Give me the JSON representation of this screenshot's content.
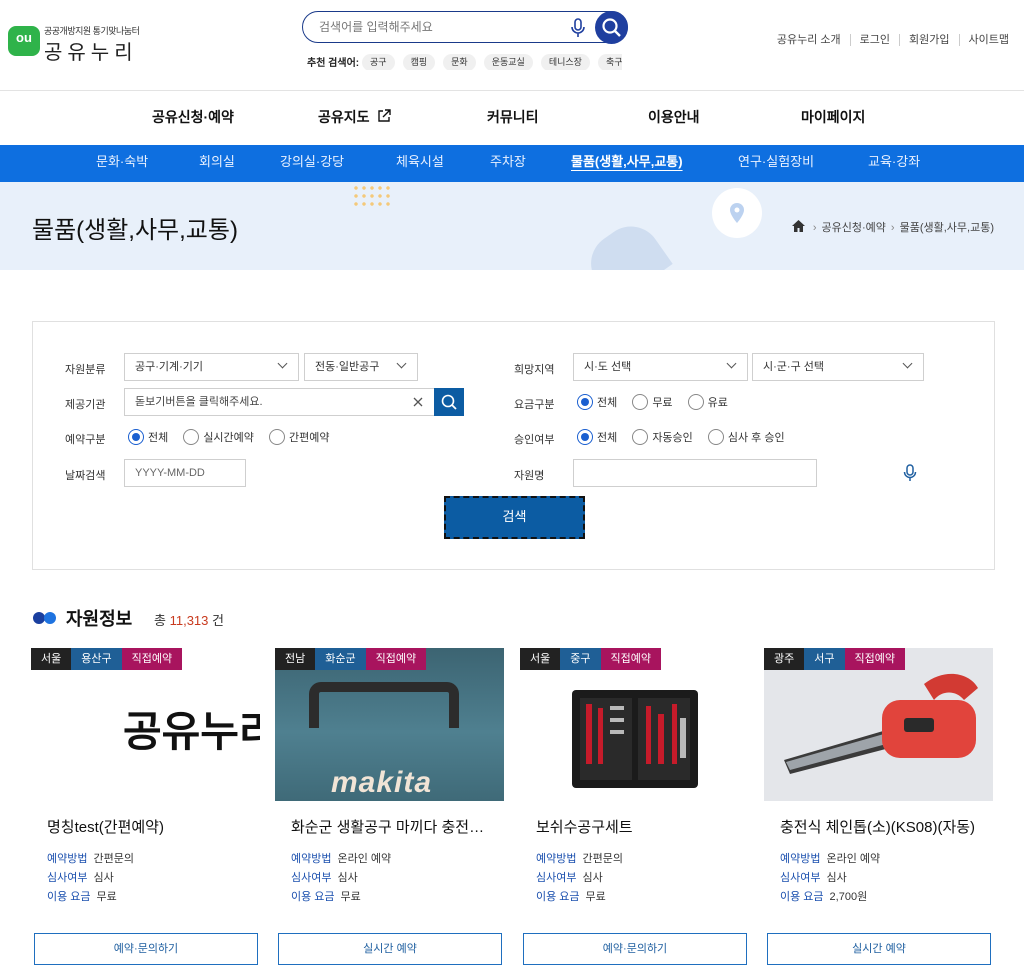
{
  "header": {
    "logo_mark": "ou",
    "logo_sub": "공공개방지원 통기맞나눔터",
    "logo_name": "공유누리",
    "search_placeholder": "검색어를 입력해주세요",
    "recommend_label": "추천 검색어:",
    "recommend": [
      "공구",
      "캠핑",
      "문화",
      "운동교실",
      "테니스장",
      "축구장"
    ],
    "util": [
      "공유누리 소개",
      "로그인",
      "회원가입",
      "사이트맵"
    ]
  },
  "gnb": [
    "공유신청·예약",
    "공유지도",
    "커뮤니티",
    "이용안내",
    "마이페이지"
  ],
  "subnav": {
    "items": [
      "문화·숙박",
      "회의실",
      "강의실·강당",
      "체육시설",
      "주차장",
      "물품(생활,사무,교통)",
      "연구·실험장비",
      "교육·강좌"
    ],
    "active_index": 5
  },
  "banner": {
    "title": "물품(생활,사무,교통)",
    "breadcrumb": [
      "공유신청·예약",
      "물품(생활,사무,교통)"
    ]
  },
  "form": {
    "resource_type_label": "자원분류",
    "resource_type_1": "공구·기계·기기",
    "resource_type_2": "전동·일반공구",
    "region_label": "희망지역",
    "region_1": "시·도 선택",
    "region_2": "시·군·구 선택",
    "provider_label": "제공기관",
    "provider_placeholder": "돋보기버튼을 클릭해주세요.",
    "fee_label": "요금구분",
    "fee_options": [
      "전체",
      "무료",
      "유료"
    ],
    "reserve_label": "예약구분",
    "reserve_options": [
      "전체",
      "실시간예약",
      "간편예약"
    ],
    "approve_label": "승인여부",
    "approve_options": [
      "전체",
      "자동승인",
      "심사 후 승인"
    ],
    "date_label": "날짜검색",
    "date_placeholder": "YYYY-MM-DD",
    "name_label": "자원명",
    "search_button": "검색"
  },
  "resources": {
    "title": "자원정보",
    "count_prefix": "총",
    "count": "11,313",
    "count_suffix": "건",
    "method_label": "예약방법",
    "review_label": "심사여부",
    "fee_label": "이용 요금",
    "cards": [
      {
        "region": "서울",
        "district": "용산구",
        "type": "직접예약",
        "image_text": "공유누리",
        "name": "명칭test(간편예약)",
        "method": "간편문의",
        "review": "심사",
        "fee": "무료",
        "button": "예약·문의하기"
      },
      {
        "region": "전남",
        "district": "화순군",
        "type": "직접예약",
        "image_text": "makita",
        "name": "화순군 생활공구 마끼다 충전드릴",
        "method": "온라인 예약",
        "review": "심사",
        "fee": "무료",
        "button": "실시간 예약"
      },
      {
        "region": "서울",
        "district": "중구",
        "type": "직접예약",
        "image_text": "",
        "name": "보쉬수공구세트",
        "method": "간편문의",
        "review": "심사",
        "fee": "무료",
        "button": "예약·문의하기"
      },
      {
        "region": "광주",
        "district": "서구",
        "type": "직접예약",
        "image_text": "",
        "name": "충전식 체인톱(소)(KS08)(자동)",
        "method": "온라인 예약",
        "review": "심사",
        "fee": "2,700원",
        "button": "실시간 예약"
      }
    ]
  }
}
